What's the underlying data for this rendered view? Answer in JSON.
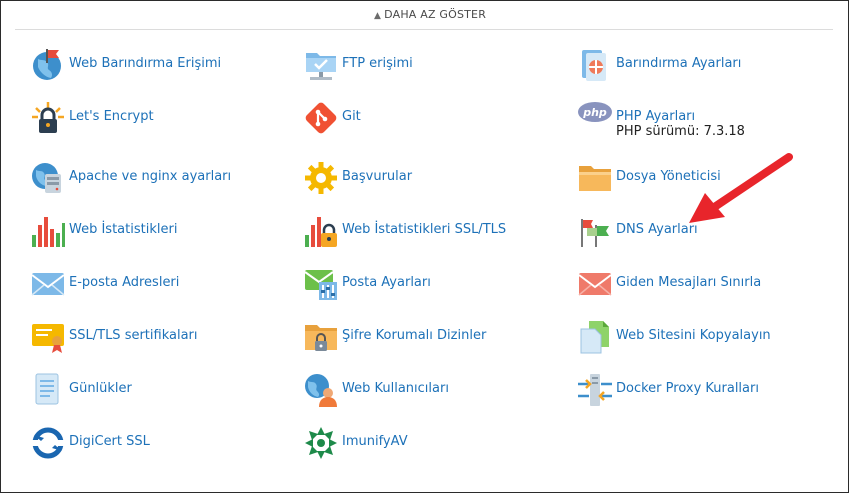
{
  "toggle": {
    "label": "DAHA AZ GÖSTER",
    "icon": "chevron-up-icon"
  },
  "tools": {
    "web_hosting_access": "Web Barındırma Erişimi",
    "ftp_access": "FTP erişimi",
    "hosting_settings": "Barındırma Ayarları",
    "lets_encrypt": "Let's Encrypt",
    "git": "Git",
    "php_settings": "PHP Ayarları",
    "php_version": "PHP sürümü: 7.3.18",
    "apache_nginx": "Apache ve nginx ayarları",
    "applications": "Başvurular",
    "file_manager": "Dosya Yöneticisi",
    "web_stats": "Web İstatistikleri",
    "web_stats_ssl": "Web İstatistikleri SSL/TLS",
    "dns_settings": "DNS Ayarları",
    "email_addresses": "E-posta Adresleri",
    "mail_settings": "Posta Ayarları",
    "outgoing_limit": "Giden Mesajları Sınırla",
    "ssl_certificates": "SSL/TLS sertifikaları",
    "password_dirs": "Şifre Korumalı Dizinler",
    "copy_website": "Web Sitesini Kopyalayın",
    "logs": "Günlükler",
    "web_users": "Web Kullanıcıları",
    "docker_proxy": "Docker Proxy Kuralları",
    "digicert": "DigiCert SSL",
    "imunify": "ImunifyAV"
  },
  "colors": {
    "link": "#1d71b8",
    "annotation_arrow": "#e8252b"
  }
}
